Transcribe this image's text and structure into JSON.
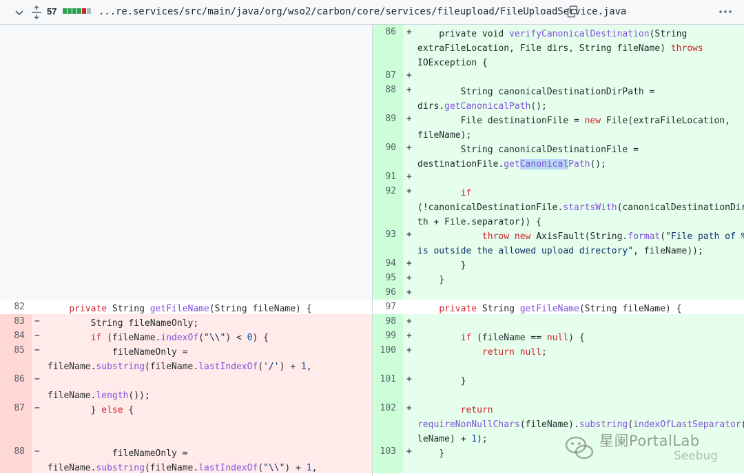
{
  "header": {
    "changes_count": "57",
    "diffstat": [
      "#2da44e",
      "#2da44e",
      "#2da44e",
      "#2da44e",
      "#cf222e",
      "#afb8c1"
    ],
    "file_path": "...re.services/src/main/java/org/wso2/carbon/core/services/fileupload/FileUploadService.java",
    "icons": [
      "chevron-down-icon",
      "unfold-icon",
      "copy-icon",
      "kebab-icon"
    ]
  },
  "rows": [
    {
      "lnum_left": "",
      "marker_left": "",
      "left_type": "empty",
      "lnum_right": "86",
      "marker_right": "+",
      "right_type": "add",
      "right_lines": [
        [
          [
            "    private void ",
            ""
          ],
          [
            "verifyCanonicalDestination",
            "fn"
          ],
          [
            "(String",
            ""
          ]
        ],
        [
          [
            "extraFileLocation, File dirs, String fileName) ",
            ""
          ],
          [
            "throws",
            "kw"
          ]
        ],
        [
          [
            "IOException {",
            ""
          ]
        ]
      ]
    },
    {
      "lnum_left": "",
      "marker_left": "",
      "left_type": "empty",
      "lnum_right": "87",
      "marker_right": "+",
      "right_type": "add",
      "right_lines": [
        [
          [
            "",
            ""
          ]
        ]
      ]
    },
    {
      "lnum_left": "",
      "marker_left": "",
      "left_type": "empty",
      "lnum_right": "88",
      "marker_right": "+",
      "right_type": "add",
      "right_lines": [
        [
          [
            "        String canonicalDestinationDirPath =",
            ""
          ]
        ],
        [
          [
            "dirs.",
            ""
          ],
          [
            "getCanonicalPath",
            "fn"
          ],
          [
            "();",
            ""
          ]
        ]
      ]
    },
    {
      "lnum_left": "",
      "marker_left": "",
      "left_type": "empty",
      "lnum_right": "89",
      "marker_right": "+",
      "right_type": "add",
      "right_lines": [
        [
          [
            "        File destinationFile = ",
            ""
          ],
          [
            "new",
            "kw"
          ],
          [
            " File(extraFileLocation,",
            ""
          ]
        ],
        [
          [
            "fileName);",
            ""
          ]
        ]
      ]
    },
    {
      "lnum_left": "",
      "marker_left": "",
      "left_type": "empty",
      "lnum_right": "90",
      "marker_right": "+",
      "right_type": "add",
      "right_lines": [
        [
          [
            "        String canonicalDestinationFile =",
            ""
          ]
        ],
        [
          [
            "destinationFile.",
            ""
          ],
          [
            "get",
            "fn"
          ],
          [
            "Canonical",
            "fn hl"
          ],
          [
            "Path",
            "fn"
          ],
          [
            "();",
            ""
          ]
        ]
      ]
    },
    {
      "lnum_left": "",
      "marker_left": "",
      "left_type": "empty",
      "lnum_right": "91",
      "marker_right": "+",
      "right_type": "add",
      "right_lines": [
        [
          [
            "",
            ""
          ]
        ]
      ]
    },
    {
      "lnum_left": "",
      "marker_left": "",
      "left_type": "empty",
      "lnum_right": "92",
      "marker_right": "+",
      "right_type": "add",
      "right_lines": [
        [
          [
            "        ",
            ""
          ],
          [
            "if",
            "kw"
          ]
        ],
        [
          [
            "(!canonicalDestinationFile.",
            ""
          ],
          [
            "startsWith",
            "fn"
          ],
          [
            "(canonicalDestinationDirPa",
            ""
          ]
        ],
        [
          [
            "th + File.separator)) {",
            ""
          ]
        ]
      ]
    },
    {
      "lnum_left": "",
      "marker_left": "",
      "left_type": "empty",
      "lnum_right": "93",
      "marker_right": "+",
      "right_type": "add",
      "right_lines": [
        [
          [
            "            ",
            ""
          ],
          [
            "throw",
            "kw"
          ],
          [
            " ",
            ""
          ],
          [
            "new",
            "kw"
          ],
          [
            " AxisFault(String.",
            ""
          ],
          [
            "format",
            "fn"
          ],
          [
            "(",
            ""
          ],
          [
            "\"File path of %s",
            "str"
          ]
        ],
        [
          [
            "is outside the allowed upload directory\"",
            "str"
          ],
          [
            ", fileName));",
            ""
          ]
        ]
      ]
    },
    {
      "lnum_left": "",
      "marker_left": "",
      "left_type": "empty",
      "lnum_right": "94",
      "marker_right": "+",
      "right_type": "add",
      "right_lines": [
        [
          [
            "        }",
            ""
          ]
        ]
      ]
    },
    {
      "lnum_left": "",
      "marker_left": "",
      "left_type": "empty",
      "lnum_right": "95",
      "marker_right": "+",
      "right_type": "add",
      "right_lines": [
        [
          [
            "    }",
            ""
          ]
        ]
      ]
    },
    {
      "lnum_left": "",
      "marker_left": "",
      "left_type": "empty",
      "lnum_right": "96",
      "marker_right": "+",
      "right_type": "add",
      "right_lines": [
        [
          [
            "",
            ""
          ]
        ]
      ]
    },
    {
      "lnum_left": "82",
      "marker_left": "",
      "left_type": "ctx",
      "left_lines": [
        [
          [
            "    ",
            ""
          ],
          [
            "private",
            "kw"
          ],
          [
            " String ",
            ""
          ],
          [
            "getFileName",
            "fn"
          ],
          [
            "(String fileName) {",
            ""
          ]
        ]
      ],
      "lnum_right": "97",
      "marker_right": "",
      "right_type": "ctx",
      "right_lines": [
        [
          [
            "    ",
            ""
          ],
          [
            "private",
            "kw"
          ],
          [
            " String ",
            ""
          ],
          [
            "getFileName",
            "fn"
          ],
          [
            "(String fileName) {",
            ""
          ]
        ]
      ]
    },
    {
      "lnum_left": "83",
      "marker_left": "−",
      "left_type": "del",
      "left_lines": [
        [
          [
            "        String fileNameOnly;",
            ""
          ]
        ]
      ],
      "lnum_right": "98",
      "marker_right": "+",
      "right_type": "add",
      "right_lines": [
        [
          [
            "",
            ""
          ]
        ]
      ]
    },
    {
      "lnum_left": "84",
      "marker_left": "−",
      "left_type": "del",
      "left_lines": [
        [
          [
            "        ",
            ""
          ],
          [
            "if",
            "kw"
          ],
          [
            " (fileName.",
            ""
          ],
          [
            "indexOf",
            "fn"
          ],
          [
            "(",
            ""
          ],
          [
            "\"\\\\\"",
            "str"
          ],
          [
            ") < ",
            ""
          ],
          [
            "0",
            "num"
          ],
          [
            ") {",
            ""
          ]
        ]
      ],
      "lnum_right": "99",
      "marker_right": "+",
      "right_type": "add",
      "right_lines": [
        [
          [
            "        ",
            ""
          ],
          [
            "if",
            "kw"
          ],
          [
            " (fileName == ",
            ""
          ],
          [
            "null",
            "kw"
          ],
          [
            ") {",
            ""
          ]
        ]
      ]
    },
    {
      "lnum_left": "85",
      "marker_left": "−",
      "left_type": "del",
      "left_lines": [
        [
          [
            "            fileNameOnly =",
            ""
          ]
        ],
        [
          [
            "fileName.",
            ""
          ],
          [
            "substring",
            "fn"
          ],
          [
            "(fileName.",
            ""
          ],
          [
            "lastIndexOf",
            "fn"
          ],
          [
            "(",
            ""
          ],
          [
            "'/'",
            "str"
          ],
          [
            ") + ",
            ""
          ],
          [
            "1",
            "num"
          ],
          [
            ",",
            ""
          ]
        ]
      ],
      "lnum_right": "100",
      "marker_right": "+",
      "right_type": "add",
      "right_lines": [
        [
          [
            "            ",
            ""
          ],
          [
            "return",
            "kw"
          ],
          [
            " ",
            ""
          ],
          [
            "null",
            "kw"
          ],
          [
            ";",
            ""
          ]
        ]
      ]
    },
    {
      "lnum_left": "86",
      "marker_left": "−",
      "left_type": "del",
      "left_lines": [
        [
          [
            "",
            ""
          ]
        ],
        [
          [
            "fileName.",
            ""
          ],
          [
            "length",
            "fn"
          ],
          [
            "());",
            ""
          ]
        ]
      ],
      "lnum_right": "101",
      "marker_right": "+",
      "right_type": "add",
      "right_lines": [
        [
          [
            "        }",
            ""
          ]
        ]
      ]
    },
    {
      "lnum_left": "87",
      "marker_left": "−",
      "left_type": "del",
      "left_lines": [
        [
          [
            "        } ",
            ""
          ],
          [
            "else",
            "kw"
          ],
          [
            " {",
            ""
          ]
        ]
      ],
      "lnum_right": "102",
      "marker_right": "+",
      "right_type": "add",
      "right_lines": [
        [
          [
            "        ",
            ""
          ],
          [
            "return",
            "kw"
          ]
        ],
        [
          [
            "requireNonNullChars",
            "fn"
          ],
          [
            "(fileName).",
            ""
          ],
          [
            "substring",
            "fn"
          ],
          [
            "(",
            ""
          ],
          [
            "indexOfLastSeparator",
            "fn"
          ],
          [
            "(fi",
            ""
          ]
        ],
        [
          [
            "leName) + ",
            ""
          ],
          [
            "1",
            "num"
          ],
          [
            ");",
            ""
          ]
        ]
      ]
    },
    {
      "lnum_left": "88",
      "marker_left": "−",
      "left_type": "del",
      "left_lines": [
        [
          [
            "            fileNameOnly =",
            ""
          ]
        ],
        [
          [
            "fileName.",
            ""
          ],
          [
            "substring",
            "fn"
          ],
          [
            "(fileName.",
            ""
          ],
          [
            "lastIndexOf",
            "fn"
          ],
          [
            "(",
            ""
          ],
          [
            "\"\\\\\"",
            "str"
          ],
          [
            ") + ",
            ""
          ],
          [
            "1",
            "num"
          ],
          [
            ",",
            ""
          ]
        ]
      ],
      "lnum_right": "103",
      "marker_right": "+",
      "right_type": "add",
      "right_lines": [
        [
          [
            "    }",
            ""
          ]
        ]
      ]
    }
  ],
  "watermark": {
    "line1": "星阑PortalLab",
    "line2": "Seebug"
  }
}
